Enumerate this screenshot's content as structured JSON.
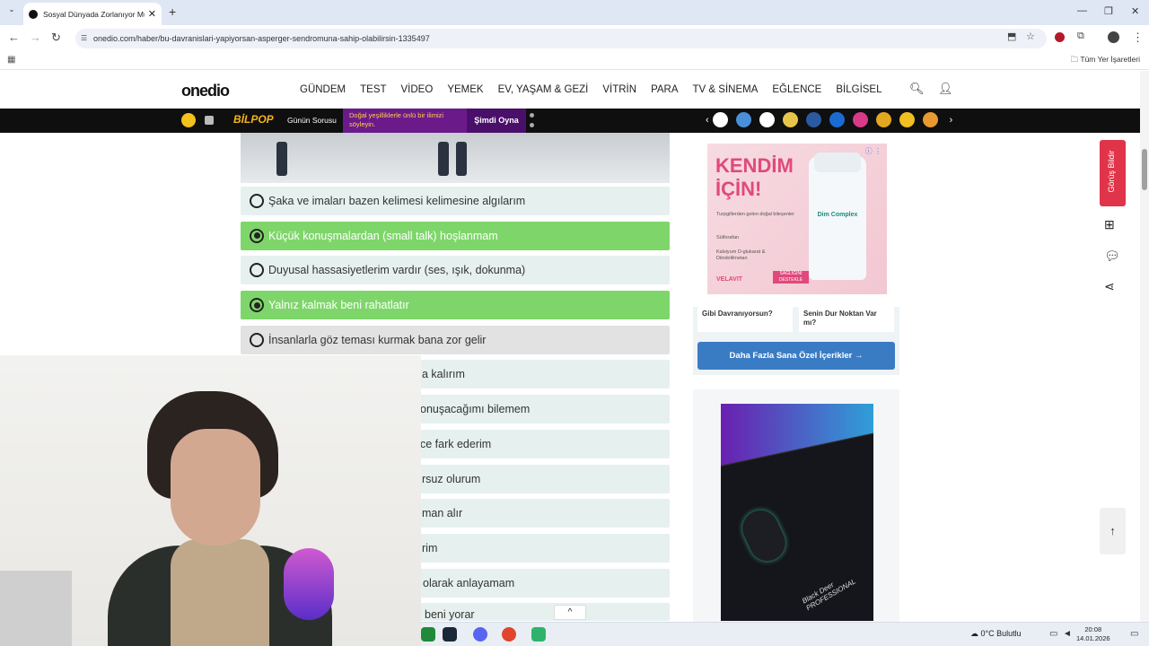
{
  "browser": {
    "tab_title": "Sosyal Dünyada Zorlanıyor Mu",
    "url": "onedio.com/haber/bu-davranislari-yapiyorsan-asperger-sendromuna-sahip-olabilirsin-1335497",
    "bookmarks_all": "Tüm Yer İşaretleri"
  },
  "site": {
    "logo": "onedio",
    "menu": [
      "GÜNDEM",
      "TEST",
      "VİDEO",
      "YEMEK",
      "EV, YAŞAM & GEZİ",
      "VİTRİN",
      "PARA",
      "TV & SİNEMA",
      "EĞLENCE",
      "BİLGİSEL"
    ]
  },
  "promo_bar": {
    "brand": "BİLPOP",
    "label": "Günün Sorusu",
    "question": "Doğal yeşilliklerle ünlü bir ilimizi söyleyin.",
    "cta": "Şimdi Oyna"
  },
  "options": [
    {
      "text": "Şaka ve imaları bazen kelimesi kelimesine algılarım",
      "state": "default"
    },
    {
      "text": "Küçük konuşmalardan (small talk) hoşlanmam",
      "state": "selected"
    },
    {
      "text": "Duyusal hassasiyetlerim vardır (ses, ışık, dokunma)",
      "state": "default"
    },
    {
      "text": "Yalnız kalmak beni rahatlatır",
      "state": "selected"
    },
    {
      "text": "İnsanlarla göz teması kurmak bana zor gelir",
      "state": "hover"
    },
    {
      "text": "a kalırım",
      "state": "default"
    },
    {
      "text": "onuşacağımı bilemem",
      "state": "default"
    },
    {
      "text": "ce fark ederim",
      "state": "default"
    },
    {
      "text": "rsuz olurum",
      "state": "default"
    },
    {
      "text": "man alır",
      "state": "default"
    },
    {
      "text": "rim",
      "state": "default"
    },
    {
      "text": "olarak anlayamam",
      "state": "default"
    },
    {
      "text": "beni yorar",
      "state": "default"
    }
  ],
  "sidebar": {
    "ad1": {
      "headline": "KENDİM İÇİN!",
      "bullet1": "Turpgillerden gelen doğal bileşenler",
      "bullet2": "Sülforafan",
      "bullet3": "Kalsiyum D-glukarat & Diindolilmetan",
      "brand": "VELAVIT",
      "product": "Dim Complex",
      "badge": "SAĞLIĞINI DESTEKLE"
    },
    "card1": "Gibi Davranıyorsun?",
    "card2": "Senin Dur Noktan Var mı?",
    "more_button": "Daha Fazla Sana Özel İçerikler",
    "ad2_text": "Black Deer PROFESSIONAL"
  },
  "feedback": "Görüş Bildir",
  "taskbar": {
    "weather": "0°C  Bulutlu",
    "time": "20:08",
    "date": "14.01.2026"
  }
}
